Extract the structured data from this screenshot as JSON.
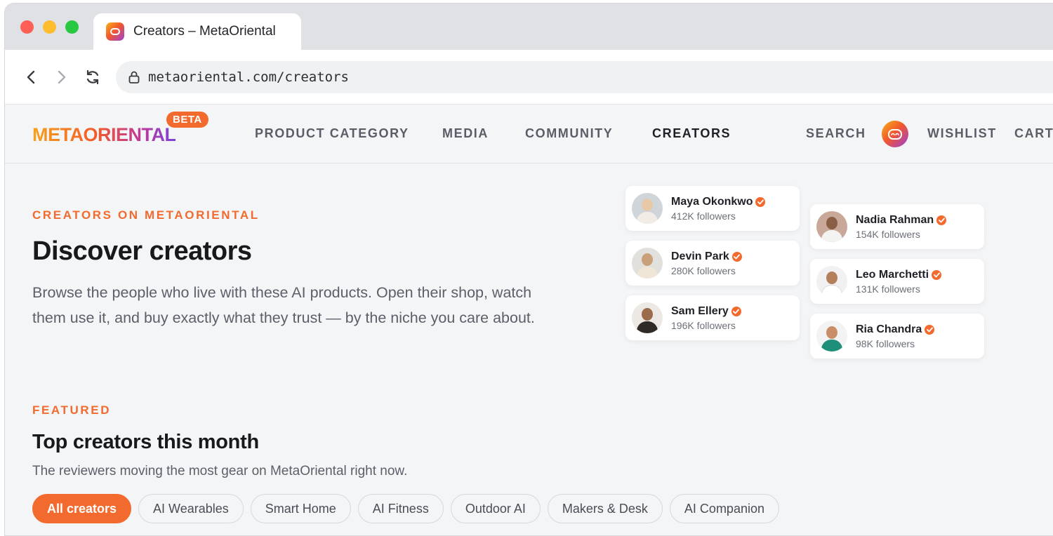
{
  "browser": {
    "tab_title": "Creators – MetaOriental",
    "url": "metaoriental.com/creators"
  },
  "header": {
    "logo": "METAORIENTAL",
    "beta_badge": "BETA",
    "nav": {
      "product_category": "PRODUCT CATEGORY",
      "media": "MEDIA",
      "community": "COMMUNITY",
      "creators": "CREATORS",
      "search": "SEARCH",
      "wishlist": "WISHLIST",
      "cart": "CART"
    }
  },
  "hero": {
    "eyebrow": "CREATORS ON METAORIENTAL",
    "title": "Discover creators",
    "description": "Browse the people who live with these AI products. Open their shop, watch them use it, and buy exactly what they trust — by the niche you care about."
  },
  "creators": [
    {
      "name": "Maya Okonkwo",
      "followers": "412K followers"
    },
    {
      "name": "Devin Park",
      "followers": "280K followers"
    },
    {
      "name": "Sam Ellery",
      "followers": "196K followers"
    },
    {
      "name": "Nadia Rahman",
      "followers": "154K followers"
    },
    {
      "name": "Leo Marchetti",
      "followers": "131K followers"
    },
    {
      "name": "Ria Chandra",
      "followers": "98K followers"
    }
  ],
  "featured": {
    "eyebrow": "FEATURED",
    "title": "Top creators this month",
    "subtitle": "The reviewers moving the most gear on MetaOriental right now.",
    "filters": [
      "All creators",
      "AI Wearables",
      "Smart Home",
      "AI Fitness",
      "Outdoor AI",
      "Makers & Desk",
      "AI Companion"
    ],
    "active_filter": "All creators"
  },
  "colors": {
    "accent": "#f26a2e",
    "verified_badge": "#f26a2e"
  }
}
